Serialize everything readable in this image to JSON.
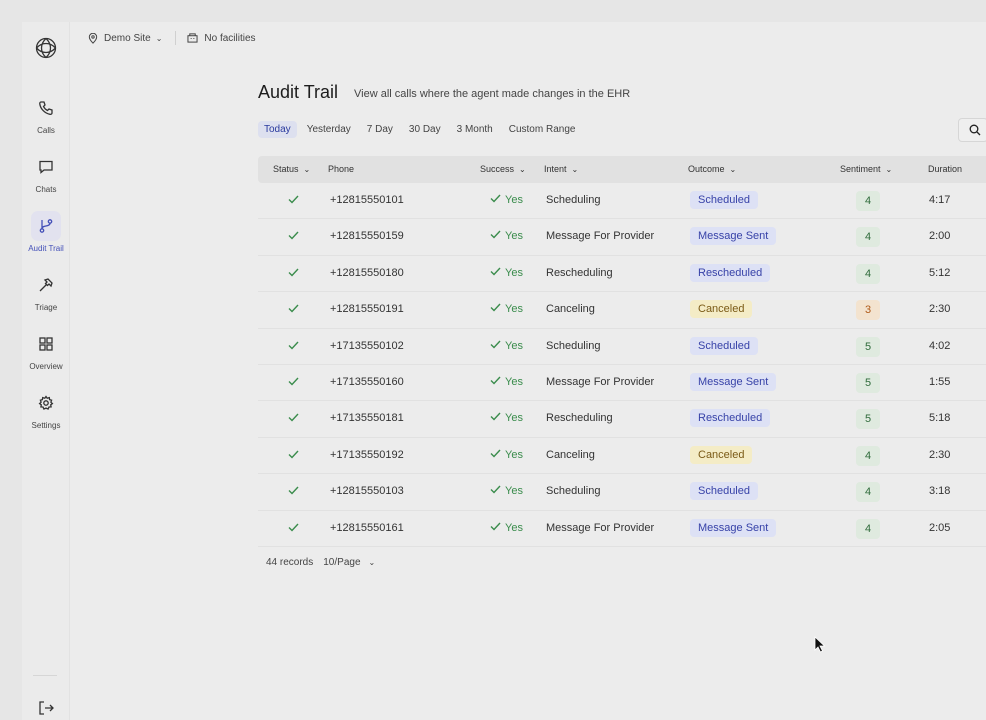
{
  "topbar": {
    "site": "Demo Site",
    "facilities": "No facilities"
  },
  "sidebar": {
    "items": [
      {
        "label": "Calls",
        "icon": "phone-icon"
      },
      {
        "label": "Chats",
        "icon": "chat-icon"
      },
      {
        "label": "Audit Trail",
        "icon": "audit-trail-icon",
        "active": true
      },
      {
        "label": "Triage",
        "icon": "hammer-icon"
      },
      {
        "label": "Overview",
        "icon": "grid-icon"
      },
      {
        "label": "Settings",
        "icon": "gear-icon"
      }
    ]
  },
  "page": {
    "title": "Audit Trail",
    "subtitle": "View all calls where the agent made changes in the EHR"
  },
  "filters": [
    "Today",
    "Yesterday",
    "7 Day",
    "30 Day",
    "3 Month",
    "Custom Range"
  ],
  "active_filter": "Today",
  "table": {
    "columns": {
      "status": "Status",
      "phone": "Phone",
      "success": "Success",
      "intent": "Intent",
      "outcome": "Outcome",
      "sentiment": "Sentiment",
      "duration": "Duration"
    },
    "rows": [
      {
        "phone": "+12815550101",
        "success": "Yes",
        "intent": "Scheduling",
        "outcome": "Scheduled",
        "outcome_color": "blue",
        "sentiment": "4",
        "sentiment_color": "green",
        "duration": "4:17"
      },
      {
        "phone": "+12815550159",
        "success": "Yes",
        "intent": "Message For Provider",
        "outcome": "Message Sent",
        "outcome_color": "blue",
        "sentiment": "4",
        "sentiment_color": "green",
        "duration": "2:00"
      },
      {
        "phone": "+12815550180",
        "success": "Yes",
        "intent": "Rescheduling",
        "outcome": "Rescheduled",
        "outcome_color": "blue",
        "sentiment": "4",
        "sentiment_color": "green",
        "duration": "5:12"
      },
      {
        "phone": "+12815550191",
        "success": "Yes",
        "intent": "Canceling",
        "outcome": "Canceled",
        "outcome_color": "yellow",
        "sentiment": "3",
        "sentiment_color": "orange",
        "duration": "2:30"
      },
      {
        "phone": "+17135550102",
        "success": "Yes",
        "intent": "Scheduling",
        "outcome": "Scheduled",
        "outcome_color": "blue",
        "sentiment": "5",
        "sentiment_color": "green",
        "duration": "4:02"
      },
      {
        "phone": "+17135550160",
        "success": "Yes",
        "intent": "Message For Provider",
        "outcome": "Message Sent",
        "outcome_color": "blue",
        "sentiment": "5",
        "sentiment_color": "green",
        "duration": "1:55"
      },
      {
        "phone": "+17135550181",
        "success": "Yes",
        "intent": "Rescheduling",
        "outcome": "Rescheduled",
        "outcome_color": "blue",
        "sentiment": "5",
        "sentiment_color": "green",
        "duration": "5:18"
      },
      {
        "phone": "+17135550192",
        "success": "Yes",
        "intent": "Canceling",
        "outcome": "Canceled",
        "outcome_color": "yellow",
        "sentiment": "4",
        "sentiment_color": "green",
        "duration": "2:30"
      },
      {
        "phone": "+12815550103",
        "success": "Yes",
        "intent": "Scheduling",
        "outcome": "Scheduled",
        "outcome_color": "blue",
        "sentiment": "4",
        "sentiment_color": "green",
        "duration": "3:18"
      },
      {
        "phone": "+12815550161",
        "success": "Yes",
        "intent": "Message For Provider",
        "outcome": "Message Sent",
        "outcome_color": "blue",
        "sentiment": "4",
        "sentiment_color": "green",
        "duration": "2:05"
      }
    ]
  },
  "footer": {
    "records": "44 records",
    "per_page": "10/Page"
  }
}
